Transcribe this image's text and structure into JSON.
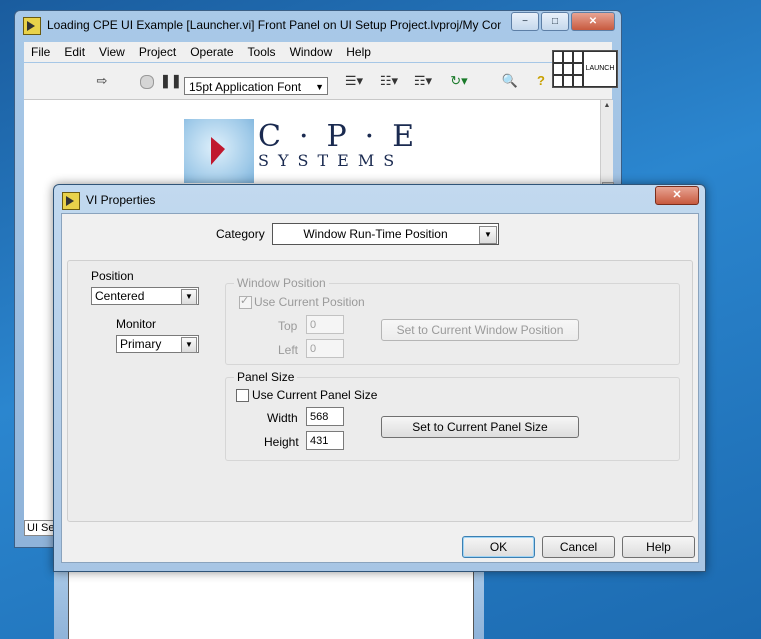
{
  "back_window": {
    "title": "Loading CPE UI Example [Launcher.vi] Front Panel on UI Setup Project.lvproj/My Com...",
    "caption_min": "−",
    "caption_max": "□",
    "caption_close": "✕",
    "menu": [
      "File",
      "Edit",
      "View",
      "Project",
      "Operate",
      "Tools",
      "Window",
      "Help"
    ],
    "toolbar": {
      "font_select": "15pt Application Font",
      "launch_label": "LAUNCH"
    },
    "logo": {
      "top": "C·P·E",
      "bottom": "SYSTEMS"
    },
    "status_fragment": "UI Se"
  },
  "dialog": {
    "title": "VI Properties",
    "close": "✕",
    "category_label": "Category",
    "category_value": "Window Run-Time Position",
    "position_label": "Position",
    "position_value": "Centered",
    "monitor_label": "Monitor",
    "monitor_value": "Primary",
    "window_position": {
      "title": "Window Position",
      "use_current_label": "Use Current Position",
      "use_current_checked": true,
      "top_label": "Top",
      "top_value": "0",
      "left_label": "Left",
      "left_value": "0",
      "set_button": "Set to Current Window Position"
    },
    "panel_size": {
      "title": "Panel Size",
      "use_current_label": "Use Current Panel Size",
      "use_current_checked": false,
      "width_label": "Width",
      "width_value": "568",
      "height_label": "Height",
      "height_value": "431",
      "set_button": "Set to Current Panel Size"
    },
    "buttons": {
      "ok": "OK",
      "cancel": "Cancel",
      "help": "Help"
    }
  }
}
